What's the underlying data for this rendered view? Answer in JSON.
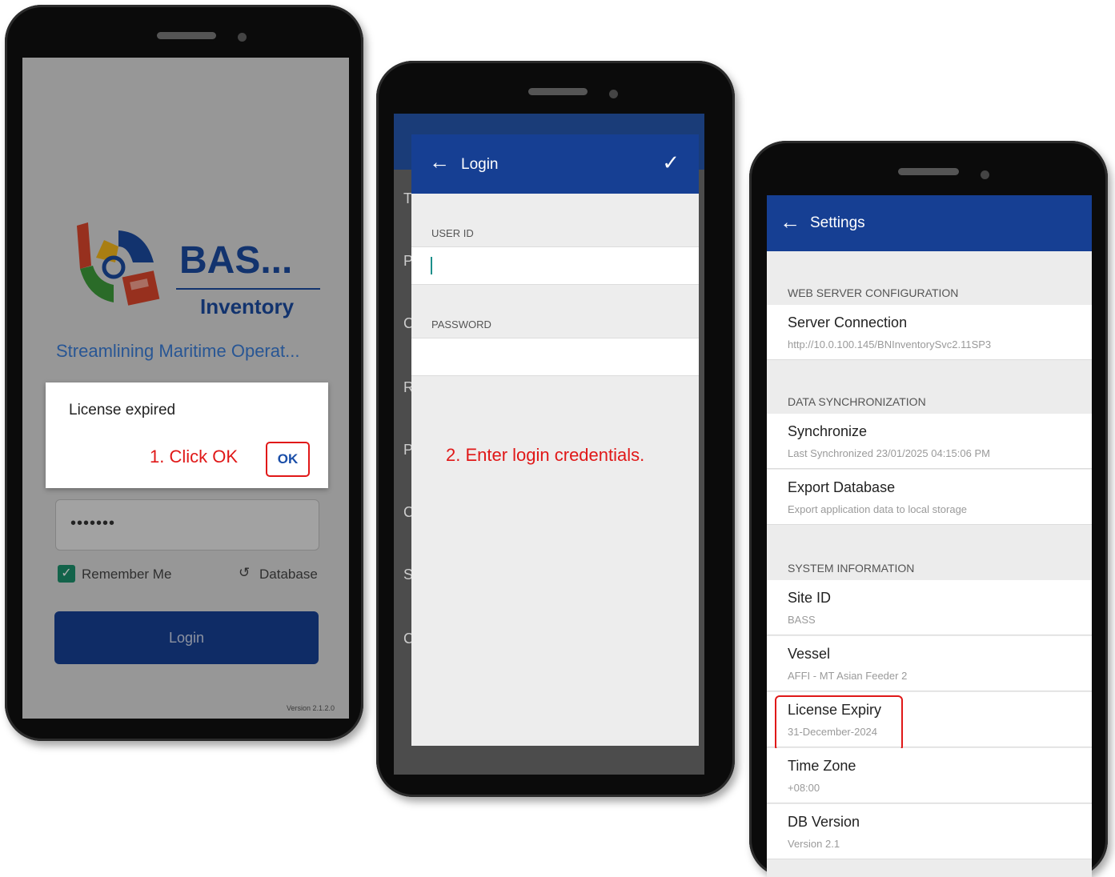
{
  "phone1": {
    "brand_main": "BAS...",
    "brand_sub": "Inventory",
    "tagline": "Streamlining Maritime Operat...",
    "password_masked": "•••••••",
    "remember_me_label": "Remember Me",
    "database_label": "Database",
    "login_button": "Login",
    "version": "Version 2.1.2.0",
    "dialog": {
      "title": "License expired",
      "instruction": "1. Click OK",
      "ok_label": "OK"
    }
  },
  "phone2": {
    "appbar_title": "Login",
    "user_id_label": "USER ID",
    "password_label": "PASSWORD",
    "instruction": "2. Enter login credentials.",
    "background_letters": [
      "T",
      "P",
      "C",
      "R",
      "P",
      "C",
      "S",
      "C"
    ]
  },
  "phone3": {
    "appbar_title": "Settings",
    "sections": {
      "web": "WEB SERVER CONFIGURATION",
      "sync": "DATA SYNCHRONIZATION",
      "system": "SYSTEM INFORMATION"
    },
    "server_connection": {
      "title": "Server Connection",
      "subtitle": "http://10.0.100.145/BNInventorySvc2.11SP3"
    },
    "synchronize": {
      "title": "Synchronize",
      "subtitle": "Last Synchronized 23/01/2025 04:15:06 PM"
    },
    "export_database": {
      "title": "Export Database",
      "subtitle": "Export application data to local storage"
    },
    "site_id": {
      "title": "Site ID",
      "subtitle": "BASS"
    },
    "vessel": {
      "title": "Vessel",
      "subtitle": "AFFI - MT Asian Feeder 2"
    },
    "license_expiry": {
      "title": "License Expiry",
      "subtitle": "31-December-2024"
    },
    "time_zone": {
      "title": "Time Zone",
      "subtitle": "+08:00"
    },
    "db_version": {
      "title": "DB Version",
      "subtitle": "Version 2.1"
    }
  },
  "colors": {
    "primary": "#163f93",
    "annotation_red": "#e01818",
    "check_green": "#1c8f6a"
  }
}
